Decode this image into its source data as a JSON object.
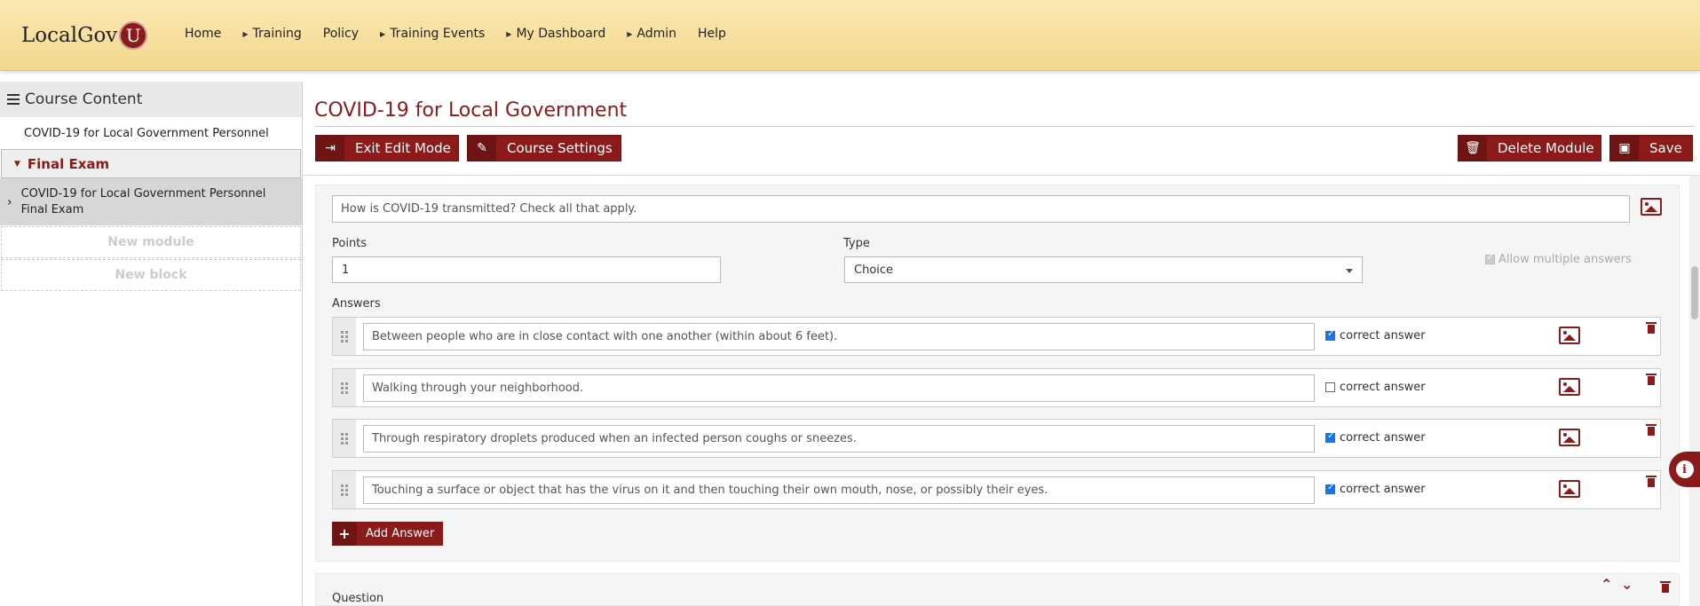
{
  "header": {
    "logo_text": "LocalGov",
    "logo_badge": "U",
    "nav": [
      {
        "label": "Home",
        "has_caret": false
      },
      {
        "label": "Training",
        "has_caret": true
      },
      {
        "label": "Policy",
        "has_caret": false
      },
      {
        "label": "Training Events",
        "has_caret": true
      },
      {
        "label": "My Dashboard",
        "has_caret": true
      },
      {
        "label": "Admin",
        "has_caret": true
      },
      {
        "label": "Help",
        "has_caret": false
      }
    ]
  },
  "sidebar": {
    "title": "Course Content",
    "course": "COVID-19 for Local Government Personnel",
    "section": "Final Exam",
    "module_line1": "COVID-19 for Local Government Personnel",
    "module_line2": "Final Exam",
    "new_module": "New module",
    "new_block": "New block"
  },
  "page": {
    "title": "COVID-19 for Local Government"
  },
  "toolbar": {
    "exit_label": "Exit Edit Mode",
    "settings_label": "Course Settings",
    "delete_label": "Delete Module",
    "save_label": "Save"
  },
  "question": {
    "text": "How is COVID-19 transmitted? Check all that apply.",
    "points_label": "Points",
    "points_value": "1",
    "type_label": "Type",
    "type_value": "Choice",
    "allow_multiple_label": "Allow multiple answers",
    "allow_multiple_checked": true,
    "answers_label": "Answers",
    "answers": [
      {
        "text": "Between people who are in close contact with one another (within about 6 feet).",
        "correct": true
      },
      {
        "text": "Walking through your neighborhood.",
        "correct": false
      },
      {
        "text": "Through respiratory droplets produced when an infected person coughs or sneezes.",
        "correct": true
      },
      {
        "text": "Touching a surface or object that has the virus on it and then touching their own mouth, nose, or possibly their eyes.",
        "correct": true
      }
    ],
    "correct_label": "correct answer",
    "add_answer_label": "Add Answer"
  },
  "next_question": {
    "label": "Question"
  },
  "colors": {
    "brand": "#8b1a1a",
    "header_bg": "#f7e0a0"
  }
}
